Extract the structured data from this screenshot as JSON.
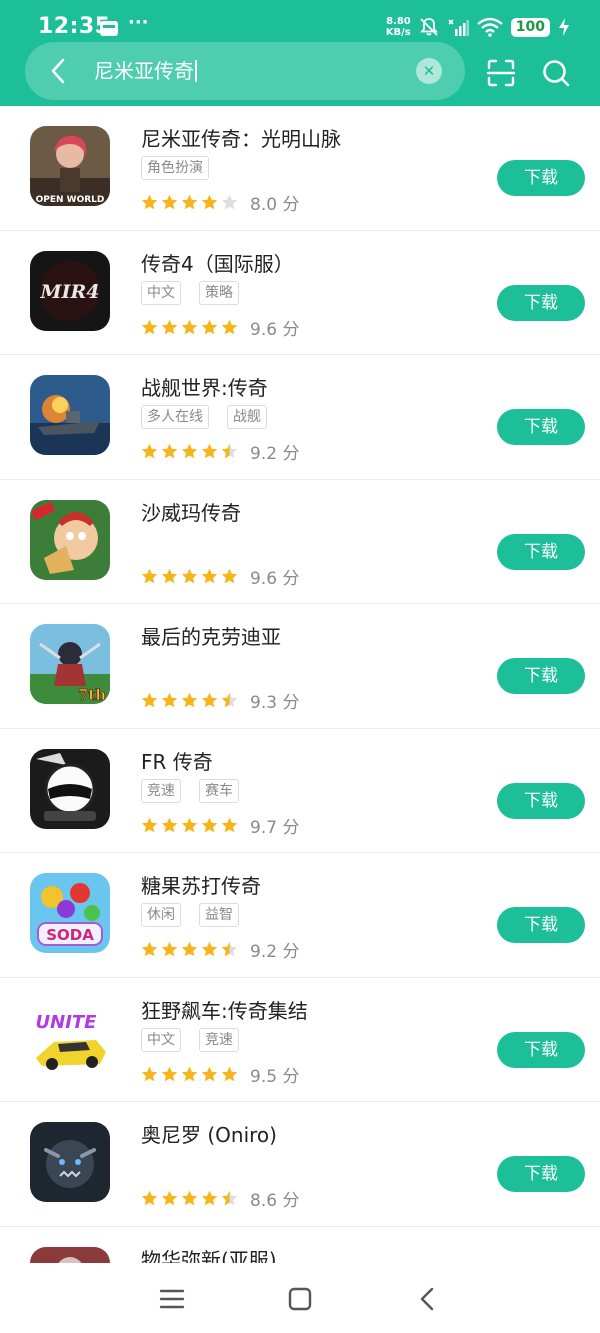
{
  "status_bar": {
    "time": "12:35",
    "dots": "···",
    "net_speed_value": "8.80",
    "net_speed_unit": "KB/s",
    "battery": "100"
  },
  "search": {
    "query": "尼米亚传奇"
  },
  "colors": {
    "accent": "#1dbf99",
    "star": "#f7b51b",
    "star_empty": "#dedede"
  },
  "apps": [
    {
      "name": "尼米亚传奇：光明山脉",
      "tags": [
        "角色扮演"
      ],
      "score": "8.0 分",
      "stars": 4,
      "icon": "open-world-app-icon",
      "icon_text": "OPEN WORLD"
    },
    {
      "name": "传奇4（国际服）",
      "tags": [
        "中文",
        "策略"
      ],
      "score": "9.6 分",
      "stars": 5,
      "icon": "mir4-app-icon",
      "icon_text": "MIR4"
    },
    {
      "name": "战舰世界:传奇",
      "tags": [
        "多人在线",
        "战舰"
      ],
      "score": "9.2 分",
      "stars": 4.5,
      "icon": "warship-app-icon"
    },
    {
      "name": "沙威玛传奇",
      "tags": [],
      "score": "9.6 分",
      "stars": 5,
      "icon": "shawarma-app-icon"
    },
    {
      "name": "最后的克劳迪亚",
      "tags": [],
      "score": "9.3 分",
      "stars": 4.5,
      "icon": "claudia-app-icon",
      "icon_text": "7th"
    },
    {
      "name": "FR 传奇",
      "tags": [
        "竞速",
        "赛车"
      ],
      "score": "9.7 分",
      "stars": 5,
      "icon": "racer-helmet-app-icon"
    },
    {
      "name": "糖果苏打传奇",
      "tags": [
        "休闲",
        "益智"
      ],
      "score": "9.2 分",
      "stars": 4.5,
      "icon": "candy-soda-app-icon",
      "icon_text": "SODA"
    },
    {
      "name": "狂野飙车:传奇集结",
      "tags": [
        "中文",
        "竞速"
      ],
      "score": "9.5 分",
      "stars": 5,
      "icon": "asphalt-app-icon",
      "icon_text": "UNITE"
    },
    {
      "name": "奥尼罗 (Oniro)",
      "tags": [],
      "score": "8.6 分",
      "stars": 4.5,
      "icon": "oniro-app-icon"
    },
    {
      "name": "物华弥新(亚服)",
      "tags": [],
      "score": "",
      "stars": 0,
      "icon": "partial-app-icon"
    }
  ],
  "download_label": "下载"
}
